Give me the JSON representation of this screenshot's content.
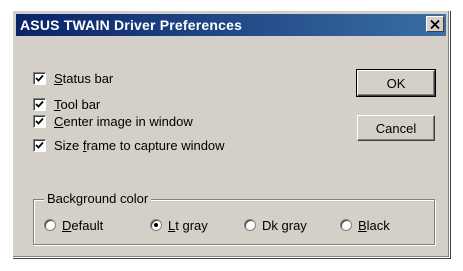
{
  "window": {
    "title": "ASUS TWAIN Driver Preferences",
    "close_glyph": "✕"
  },
  "options": [
    {
      "mnemonic": "S",
      "rest": "tatus bar",
      "checked": true
    },
    {
      "mnemonic": "T",
      "rest": "ool bar",
      "checked": true
    },
    {
      "mnemonic": "C",
      "rest": "enter image in window",
      "checked": true
    },
    {
      "prefix": "Size ",
      "mnemonic": "f",
      "rest": "rame to capture window",
      "checked": true
    }
  ],
  "buttons": {
    "ok": "OK",
    "cancel": "Cancel"
  },
  "background_color": {
    "title": "Background color",
    "choices": [
      {
        "mnemonic": "D",
        "rest": "efault",
        "selected": false
      },
      {
        "mnemonic": "L",
        "rest": "t gray",
        "selected": true
      },
      {
        "prefix": "Dk ",
        "mnemonic": "g",
        "rest": "ray",
        "selected": false
      },
      {
        "mnemonic": "B",
        "rest": "lack",
        "selected": false
      }
    ]
  },
  "colors": {
    "title_bar_start": "#0a246a",
    "title_bar_end": "#3a6ea5",
    "face": "#d4d0c8"
  },
  "icons": {
    "check": "check-icon",
    "close": "close-icon"
  }
}
